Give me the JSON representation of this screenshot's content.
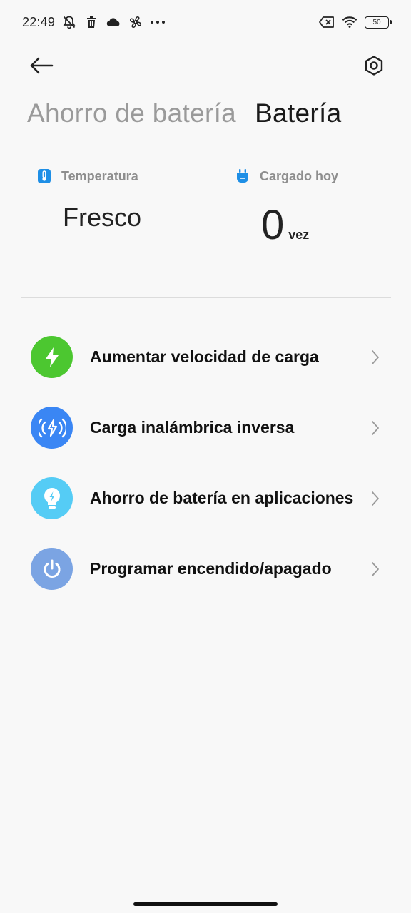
{
  "status_bar": {
    "time": "22:49",
    "battery_level": "50",
    "left_icons": [
      "mute-bell-icon",
      "trash-icon",
      "cloud-icon",
      "fan-icon",
      "more-dots-icon"
    ],
    "right_icons": [
      "no-sim-icon",
      "wifi-icon",
      "battery-icon"
    ]
  },
  "header": {
    "tabs": [
      {
        "label": "Ahorro de batería",
        "active": false
      },
      {
        "label": "Batería",
        "active": true
      }
    ]
  },
  "stats": {
    "temperature": {
      "label": "Temperatura",
      "value": "Fresco",
      "icon": "thermometer-icon",
      "color": "#1e8fe6"
    },
    "charged_today": {
      "label": "Cargado hoy",
      "value": "0",
      "unit": "vez",
      "icon": "plug-icon",
      "color": "#1e8fe6"
    }
  },
  "menu": {
    "items": [
      {
        "label": "Aumentar velocidad de carga",
        "icon": "bolt-icon",
        "color": "#4cc730"
      },
      {
        "label": "Carga inalámbrica inversa",
        "icon": "wireless-charge-icon",
        "color": "#3a86f4"
      },
      {
        "label": "Ahorro de batería en aplicaciones",
        "icon": "bulb-icon",
        "color": "#55ccf5"
      },
      {
        "label": "Programar encendido/apagado",
        "icon": "power-icon",
        "color": "#7ba4e3"
      }
    ]
  },
  "colors": {
    "background": "#f8f8f8",
    "text_primary": "#1a1a1a",
    "text_inactive": "#9a9a9a",
    "accent": "#1e8fe6"
  }
}
